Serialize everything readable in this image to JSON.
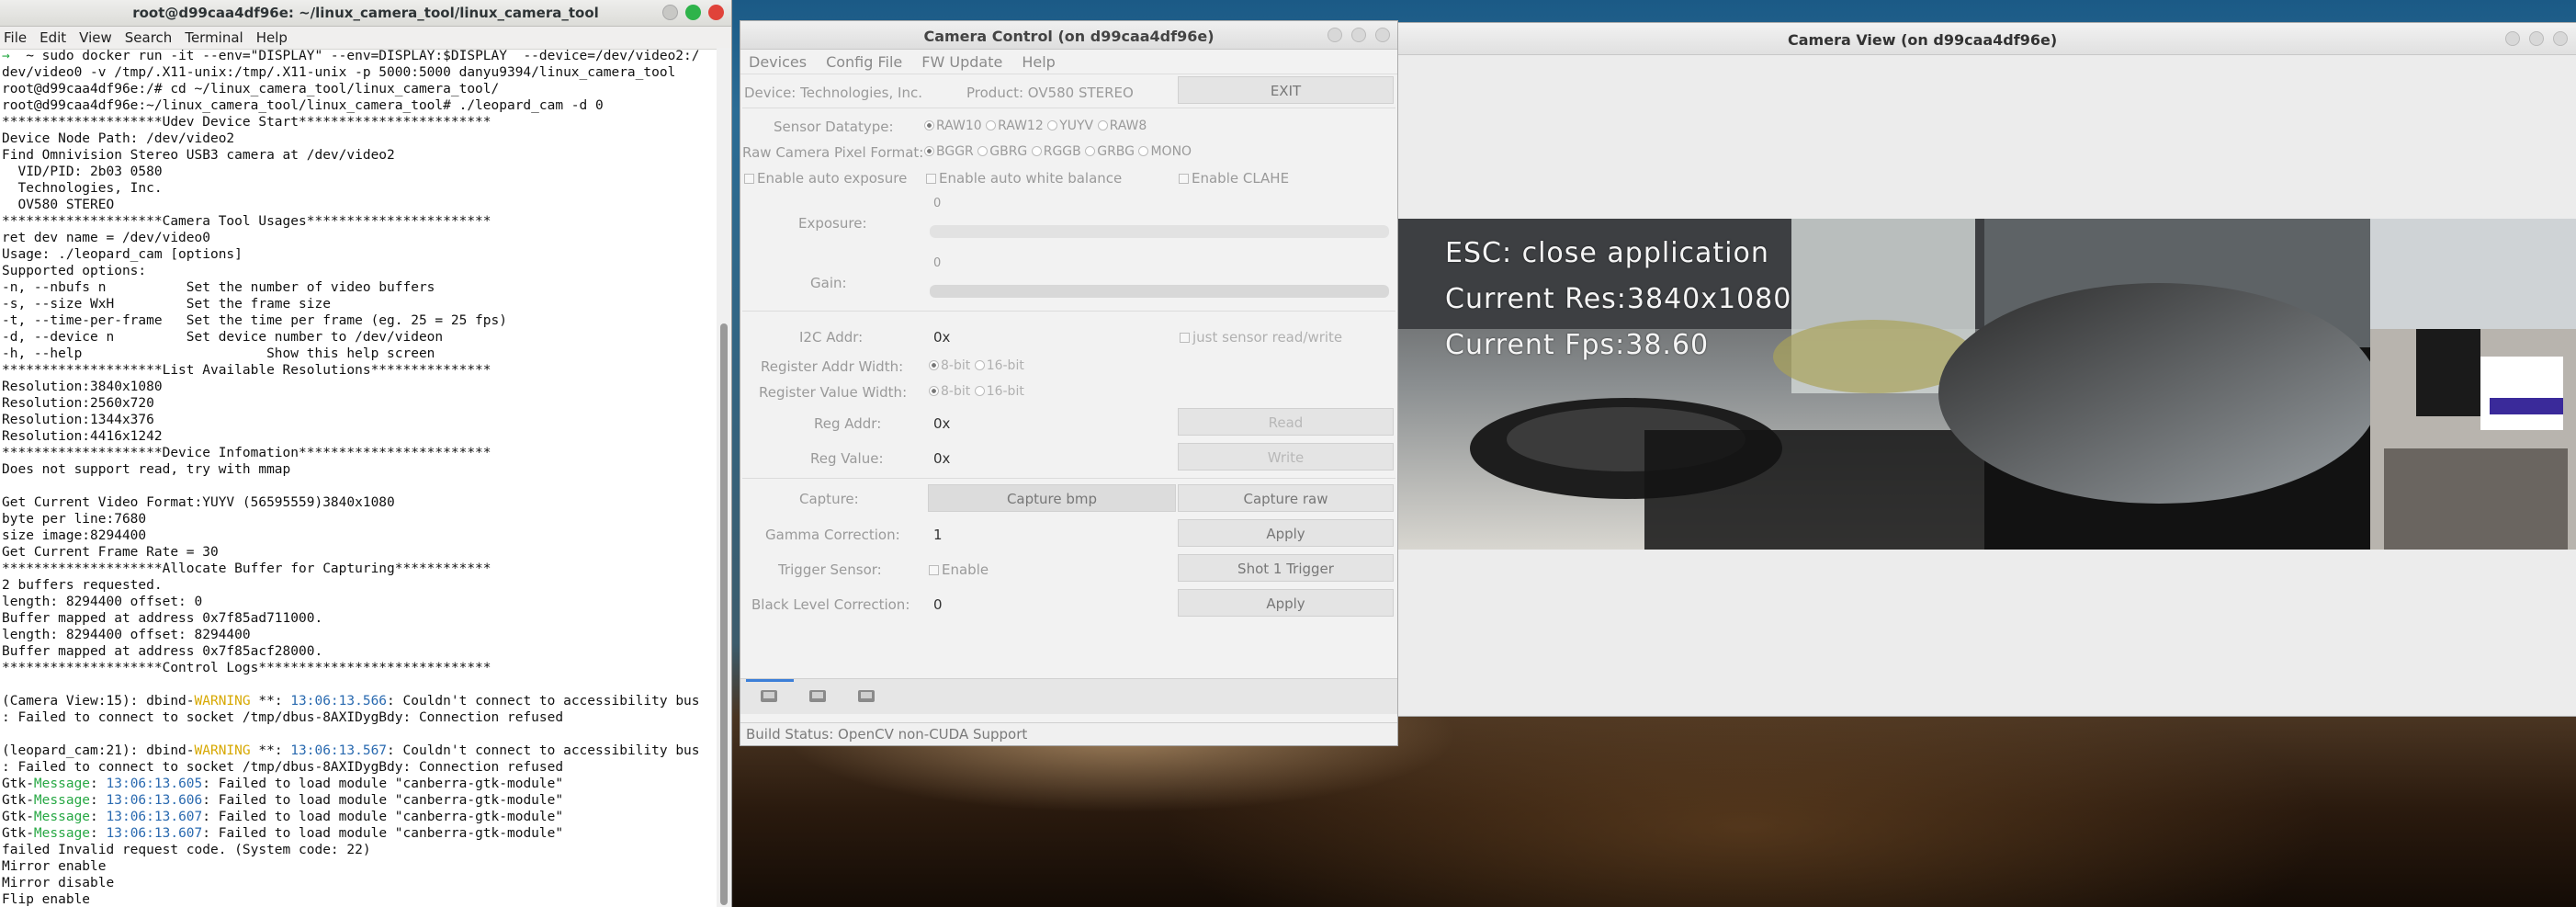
{
  "terminal": {
    "title": "root@d99caa4df96e: ~/linux_camera_tool/linux_camera_tool",
    "menu": [
      "File",
      "Edit",
      "View",
      "Search",
      "Terminal",
      "Help"
    ],
    "lines": [
      [
        {
          "t": "→ ",
          "c": "green"
        },
        {
          "t": " ~ sudo docker run -it --env=\"DISPLAY\" --env=DISPLAY:$DISPLAY  --device=/dev/video2:/"
        }
      ],
      [
        {
          "t": "dev/video0 -v /tmp/.X11-unix:/tmp/.X11-unix -p 5000:5000 danyu9394/linux_camera_tool"
        }
      ],
      [
        {
          "t": "root@d99caa4df96e:/# cd ~/linux_camera_tool/linux_camera_tool/"
        }
      ],
      [
        {
          "t": "root@d99caa4df96e:~/linux_camera_tool/linux_camera_tool# ./leopard_cam -d 0"
        }
      ],
      [
        {
          "t": "********************Udev Device Start************************"
        }
      ],
      [
        {
          "t": "Device Node Path: /dev/video2"
        }
      ],
      [
        {
          "t": "Find Omnivision Stereo USB3 camera at /dev/video2"
        }
      ],
      [
        {
          "t": "  VID/PID: 2b03 0580"
        }
      ],
      [
        {
          "t": "  Technologies, Inc."
        }
      ],
      [
        {
          "t": "  OV580 STEREO"
        }
      ],
      [
        {
          "t": "********************Camera Tool Usages***********************"
        }
      ],
      [
        {
          "t": "ret dev name = /dev/video0"
        }
      ],
      [
        {
          "t": "Usage: ./leopard_cam [options]"
        }
      ],
      [
        {
          "t": "Supported options:"
        }
      ],
      [
        {
          "t": "-n, --nbufs n          Set the number of video buffers"
        }
      ],
      [
        {
          "t": "-s, --size WxH         Set the frame size"
        }
      ],
      [
        {
          "t": "-t, --time-per-frame   Set the time per frame (eg. 25 = 25 fps)"
        }
      ],
      [
        {
          "t": "-d, --device n         Set device number to /dev/videon"
        }
      ],
      [
        {
          "t": "-h, --help                       Show this help screen"
        }
      ],
      [
        {
          "t": "********************List Available Resolutions***************"
        }
      ],
      [
        {
          "t": "Resolution:3840x1080"
        }
      ],
      [
        {
          "t": "Resolution:2560x720"
        }
      ],
      [
        {
          "t": "Resolution:1344x376"
        }
      ],
      [
        {
          "t": "Resolution:4416x1242"
        }
      ],
      [
        {
          "t": "********************Device Infomation************************"
        }
      ],
      [
        {
          "t": "Does not support read, try with mmap"
        }
      ],
      [
        {
          "t": ""
        }
      ],
      [
        {
          "t": "Get Current Video Format:YUYV (56595559)3840x1080"
        }
      ],
      [
        {
          "t": "byte per line:7680"
        }
      ],
      [
        {
          "t": "size image:8294400"
        }
      ],
      [
        {
          "t": "Get Current Frame Rate = 30"
        }
      ],
      [
        {
          "t": "********************Allocate Buffer for Capturing************"
        }
      ],
      [
        {
          "t": "2 buffers requested."
        }
      ],
      [
        {
          "t": "length: 8294400 offset: 0"
        }
      ],
      [
        {
          "t": "Buffer mapped at address 0x7f85ad711000."
        }
      ],
      [
        {
          "t": "length: 8294400 offset: 8294400"
        }
      ],
      [
        {
          "t": "Buffer mapped at address 0x7f85acf28000."
        }
      ],
      [
        {
          "t": "********************Control Logs*****************************"
        }
      ],
      [
        {
          "t": ""
        }
      ],
      [
        {
          "t": "(Camera View:15): dbind-"
        },
        {
          "t": "WARNING",
          "c": "warn"
        },
        {
          "t": " **: "
        },
        {
          "t": "13:06:13.566",
          "c": "blue"
        },
        {
          "t": ": Couldn't connect to accessibility bus"
        }
      ],
      [
        {
          "t": ": Failed to connect to socket /tmp/dbus-8AXIDygBdy: Connection refused"
        }
      ],
      [
        {
          "t": ""
        }
      ],
      [
        {
          "t": "(leopard_cam:21): dbind-"
        },
        {
          "t": "WARNING",
          "c": "warn"
        },
        {
          "t": " **: "
        },
        {
          "t": "13:06:13.567",
          "c": "blue"
        },
        {
          "t": ": Couldn't connect to accessibility bus"
        }
      ],
      [
        {
          "t": ": Failed to connect to socket /tmp/dbus-8AXIDygBdy: Connection refused"
        }
      ],
      [
        {
          "t": "Gtk-"
        },
        {
          "t": "Message",
          "c": "green"
        },
        {
          "t": ": "
        },
        {
          "t": "13:06:13.605",
          "c": "blue"
        },
        {
          "t": ": Failed to load module \"canberra-gtk-module\""
        }
      ],
      [
        {
          "t": "Gtk-"
        },
        {
          "t": "Message",
          "c": "green"
        },
        {
          "t": ": "
        },
        {
          "t": "13:06:13.606",
          "c": "blue"
        },
        {
          "t": ": Failed to load module \"canberra-gtk-module\""
        }
      ],
      [
        {
          "t": "Gtk-"
        },
        {
          "t": "Message",
          "c": "green"
        },
        {
          "t": ": "
        },
        {
          "t": "13:06:13.607",
          "c": "blue"
        },
        {
          "t": ": Failed to load module \"canberra-gtk-module\""
        }
      ],
      [
        {
          "t": "Gtk-"
        },
        {
          "t": "Message",
          "c": "green"
        },
        {
          "t": ": "
        },
        {
          "t": "13:06:13.607",
          "c": "blue"
        },
        {
          "t": ": Failed to load module \"canberra-gtk-module\""
        }
      ],
      [
        {
          "t": "failed Invalid request code. (System code: 22)"
        }
      ],
      [
        {
          "t": "Mirror enable"
        }
      ],
      [
        {
          "t": "Mirror disable"
        }
      ],
      [
        {
          "t": "Flip enable"
        }
      ]
    ]
  },
  "camera_view": {
    "title": "Camera View (on d99caa4df96e)",
    "overlay": {
      "line1": "ESC: close application",
      "line2": "Current Res:3840x1080",
      "line3": "Current Fps:38.60"
    }
  },
  "camera_control": {
    "title": "Camera Control (on d99caa4df96e)",
    "menu": [
      "Devices",
      "Config File",
      "FW Update",
      "Help"
    ],
    "device": "Device: Technologies, Inc.",
    "product": "Product: OV580 STEREO",
    "exit_label": "EXIT",
    "sensor_datatype_label": "Sensor Datatype:",
    "sensor_datatypes": [
      "RAW10",
      "RAW12",
      "YUYV",
      "RAW8"
    ],
    "pixel_format_label": "Raw Camera Pixel Format:",
    "pixel_formats": [
      "BGGR",
      "GBRG",
      "RGGB",
      "GRBG",
      "MONO"
    ],
    "auto_exposure_label": "Enable auto exposure",
    "auto_wb_label": "Enable auto white balance",
    "clahe_label": "Enable CLAHE",
    "exposure_label": "Exposure:",
    "exposure_value": "0",
    "gain_label": "Gain:",
    "gain_value": "0",
    "i2c_label": "I2C Addr:",
    "i2c_value": "0x",
    "just_sensor_label": "just sensor read/write",
    "reg_addr_width_label": "Register Addr Width:",
    "reg_value_width_label": "Register Value Width:",
    "bit_options": [
      "8-bit",
      "16-bit"
    ],
    "reg_addr_label": "Reg Addr:",
    "reg_addr_value": "0x",
    "read_label": "Read",
    "reg_value_label": "Reg Value:",
    "reg_value_value": "0x",
    "write_label": "Write",
    "capture_label": "Capture:",
    "capture_bmp_label": "Capture bmp",
    "capture_raw_label": "Capture raw",
    "gamma_label": "Gamma Correction:",
    "gamma_value": "1",
    "apply_label": "Apply",
    "trigger_label": "Trigger Sensor:",
    "enable_label": "Enable",
    "shot_trigger_label": "Shot 1 Trigger",
    "black_level_label": "Black Level Correction:",
    "black_level_value": "0",
    "build_status": "Build Status: OpenCV non-CUDA Support"
  }
}
